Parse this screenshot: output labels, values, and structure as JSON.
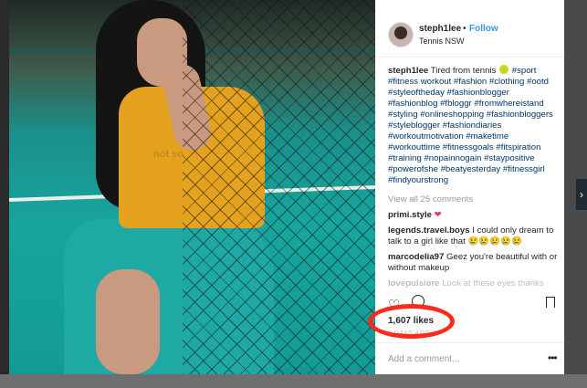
{
  "post": {
    "username": "steph1lee",
    "separator": "•",
    "follow_label": "Follow",
    "location": "Tennis NSW",
    "photo_text": "not so"
  },
  "caption": {
    "author": "steph1lee",
    "text": "Tired from tennis",
    "hashtags": "#sport #fitness workout #fashion #clothing #ootd #styleoftheday #fashionblogger #fashionblog #fbloggr #fromwhereistand #styling #onlineshopping #fashionbloggers #styleblogger #fashiondiaries #workoutmotivation #maketime #workouttime #fitnessgoals #fitspiration #training #nopainnogain #staypositive #powerofshe #beatyesterday #fitnessgirl #findyourstrong"
  },
  "view_all": "View all 25 comments",
  "comments": [
    {
      "user": "primi.style",
      "text": ""
    },
    {
      "user": "legends.travel.boys",
      "text": "I could only dream to talk to a girl like that 😢😢😢😢😢"
    },
    {
      "user": "marcodelia97",
      "text": "Geez you're beautiful with or without makeup"
    },
    {
      "user": "lovepulsiore",
      "text": "Look at these eyes thanks"
    }
  ],
  "actions": {
    "likes": "1,607 likes",
    "time": "6 DAYS AGO",
    "add_comment_placeholder": "Add a comment...",
    "more_label": "•••"
  },
  "icons": {
    "like": "heart-outline-icon",
    "comment": "speech-bubble-icon",
    "save": "bookmark-icon",
    "next": "chevron-right-icon"
  },
  "colors": {
    "link": "#3897f0",
    "hashtag": "#003569",
    "highlight": "#ff2a1c"
  }
}
